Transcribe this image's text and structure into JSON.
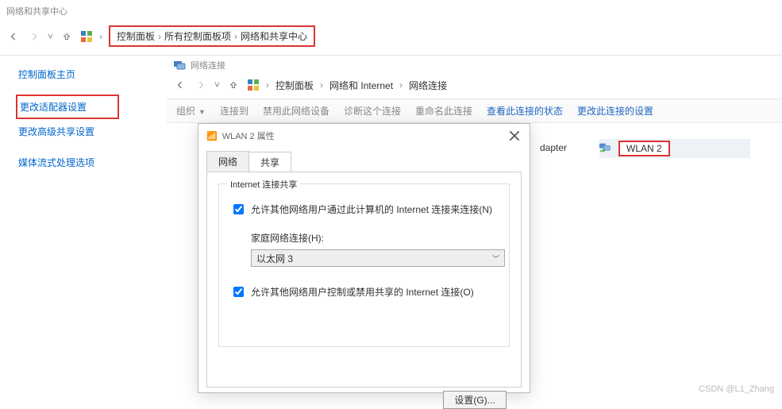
{
  "main_window": {
    "title": "网络和共享中心",
    "breadcrumb": [
      "控制面板",
      "所有控制面板项",
      "网络和共享中心"
    ]
  },
  "sidebar": {
    "items": [
      {
        "label": "控制面板主页"
      },
      {
        "label": "更改适配器设置"
      },
      {
        "label": "更改高级共享设置"
      },
      {
        "label": "媒体流式处理选项"
      }
    ]
  },
  "inner_window": {
    "title": "网络连接",
    "breadcrumb": [
      "控制面板",
      "网络和 Internet",
      "网络连接"
    ],
    "toolbar": {
      "organize": "组织",
      "connect": "连接到",
      "disable": "禁用此网络设备",
      "diagnose": "诊断这个连接",
      "rename": "重命名此连接",
      "view_status": "查看此连接的状态",
      "change_settings": "更改此连接的设置"
    },
    "adapter_fragment": "dapter",
    "connection_item": {
      "name": "WLAN 2"
    }
  },
  "dialog": {
    "title": "WLAN 2 属性",
    "tabs": {
      "network": "网络",
      "sharing": "共享"
    },
    "group_legend": "Internet 连接共享",
    "checkbox_allow_label": "允许其他网络用户通过此计算机的 Internet 连接来连接(N)",
    "home_conn_label": "家庭网络连接(H):",
    "home_conn_value": "以太网 3",
    "checkbox_control_label": "允许其他网络用户控制或禁用共享的 Internet 连接(O)",
    "settings_button": "设置(G)..."
  },
  "watermark": "CSDN @L1_Zhang"
}
